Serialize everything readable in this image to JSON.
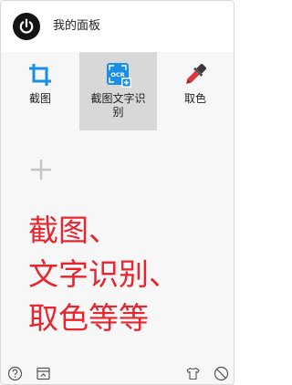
{
  "header": {
    "title": "我的面板"
  },
  "tools": [
    {
      "label": "截图",
      "icon": "crop-icon",
      "color": "#1a8fe8"
    },
    {
      "label": "截图文字识别",
      "icon": "ocr-icon",
      "color": "#1a8fe8",
      "badge": "OCR",
      "selected": true
    },
    {
      "label": "取色",
      "icon": "color-picker-icon",
      "color": "#d83a40"
    }
  ],
  "main": {
    "lines": [
      "截图、",
      "文字识别、",
      "取色等等"
    ],
    "text_color": "#e8242e"
  },
  "footer": {
    "icons": [
      "help-icon",
      "panel-toggle-icon",
      "skin-icon",
      "disable-icon"
    ]
  }
}
